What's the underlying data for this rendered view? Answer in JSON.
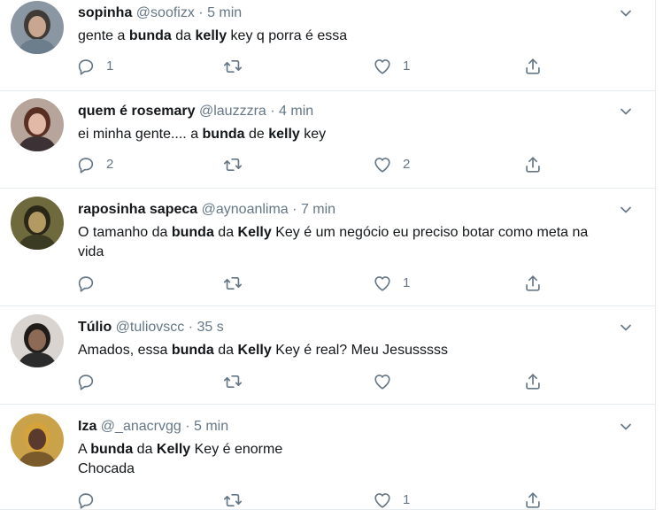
{
  "tweets": [
    {
      "name": "sopinha",
      "handle": "@soofizx",
      "sep": "·",
      "time": "5 min",
      "text": [
        {
          "t": "gente a ",
          "b": false
        },
        {
          "t": "bunda",
          "b": true
        },
        {
          "t": " da ",
          "b": false
        },
        {
          "t": "kelly",
          "b": true
        },
        {
          "t": " key q porra é essa",
          "b": false
        }
      ],
      "replies": "1",
      "retweets": "",
      "likes": "1",
      "avatar": {
        "bg": "#8a97a3",
        "hair": "#3f3a36",
        "skin": "#c9a690",
        "shirt": "#6c7d8c"
      }
    },
    {
      "name": "quem é rosemary",
      "handle": "@lauzzzra",
      "sep": "·",
      "time": "4 min",
      "text": [
        {
          "t": "ei minha gente.... a ",
          "b": false
        },
        {
          "t": "bunda",
          "b": true
        },
        {
          "t": " de ",
          "b": false
        },
        {
          "t": "kelly",
          "b": true
        },
        {
          "t": " key",
          "b": false
        }
      ],
      "replies": "2",
      "retweets": "",
      "likes": "2",
      "avatar": {
        "bg": "#b7a49a",
        "hair": "#5a2f23",
        "skin": "#e2b9a6",
        "shirt": "#3c3236"
      }
    },
    {
      "name": "raposinha sapeca",
      "handle": "@aynoanlima",
      "sep": "·",
      "time": "7 min",
      "text": [
        {
          "t": "O tamanho da ",
          "b": false
        },
        {
          "t": "bunda",
          "b": true
        },
        {
          "t": " da ",
          "b": false
        },
        {
          "t": "Kelly",
          "b": true
        },
        {
          "t": " Key é um negócio eu preciso botar como meta na vida",
          "b": false
        }
      ],
      "replies": "",
      "retweets": "",
      "likes": "1",
      "avatar": {
        "bg": "#6e6a3e",
        "hair": "#2a2618",
        "skin": "#b39a63",
        "shirt": "#3b3a22"
      }
    },
    {
      "name": "Túlio",
      "handle": "@tuliovscc",
      "sep": "·",
      "time": "35 s",
      "text": [
        {
          "t": "Amados, essa ",
          "b": false
        },
        {
          "t": "bunda",
          "b": true
        },
        {
          "t": " da ",
          "b": false
        },
        {
          "t": "Kelly",
          "b": true
        },
        {
          "t": " Key é real? Meu Jesusssss",
          "b": false
        }
      ],
      "replies": "",
      "retweets": "",
      "likes": "",
      "avatar": {
        "bg": "#d9d4cf",
        "hair": "#1f1c1a",
        "skin": "#8d6a55",
        "shirt": "#2b2b2b"
      }
    },
    {
      "name": "Iza",
      "handle": "@_anacrvgg",
      "sep": "·",
      "time": "5 min",
      "text": [
        {
          "t": "A ",
          "b": false
        },
        {
          "t": "bunda",
          "b": true
        },
        {
          "t": " da ",
          "b": false
        },
        {
          "t": "Kelly",
          "b": true
        },
        {
          "t": " Key é enorme\nChocada",
          "b": false
        }
      ],
      "replies": "",
      "retweets": "",
      "likes": "1",
      "avatar": {
        "bg": "#c9a24a",
        "hair": "#d6a23a",
        "skin": "#5a3a2c",
        "shirt": "#7a5a2a"
      }
    }
  ],
  "colors": {
    "icon": "#657786",
    "text": "#14171a",
    "muted": "#657786",
    "divider": "#e6ecf0"
  },
  "icons": {
    "reply": "reply-icon",
    "retweet": "retweet-icon",
    "like": "heart-icon",
    "share": "share-icon",
    "caret": "chevron-down-icon"
  }
}
